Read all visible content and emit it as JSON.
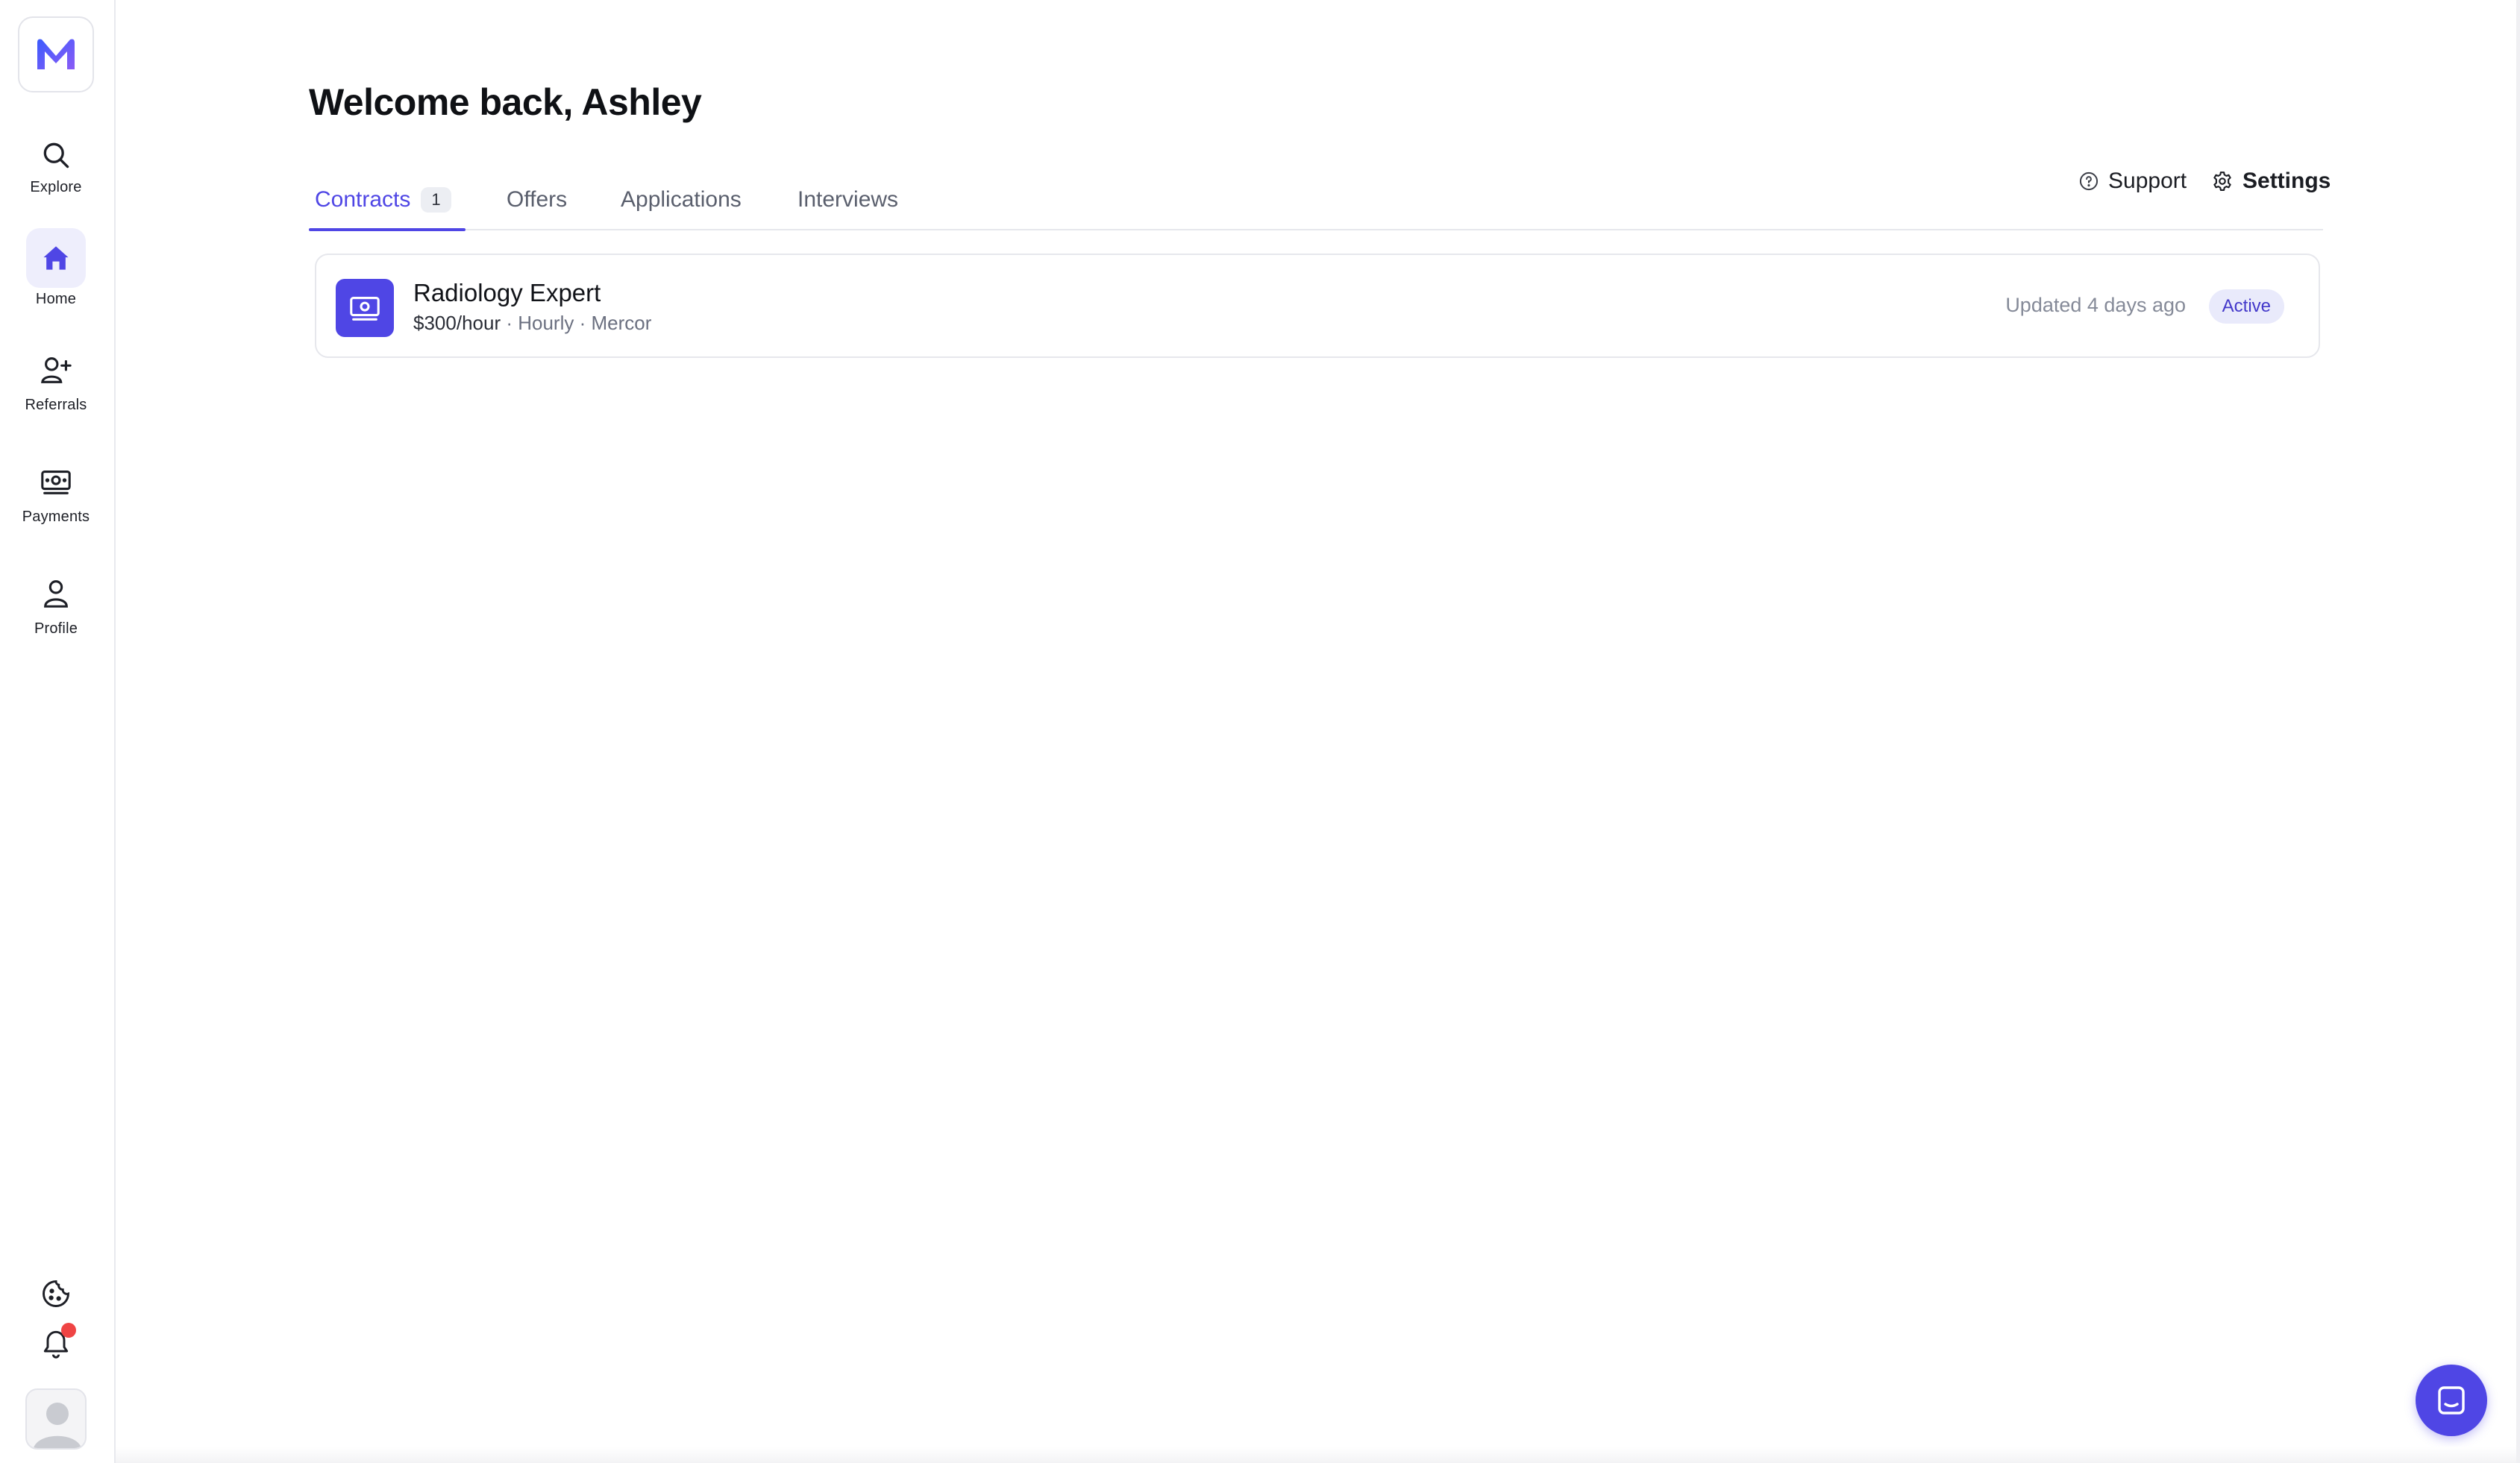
{
  "app": {
    "brand_letter": "M",
    "accent": "#4f46e5"
  },
  "sidebar": {
    "items": [
      {
        "label": "Explore",
        "icon": "search-icon"
      },
      {
        "label": "Home",
        "icon": "home-icon",
        "active": true
      },
      {
        "label": "Referrals",
        "icon": "add-user-icon"
      },
      {
        "label": "Payments",
        "icon": "money-icon"
      },
      {
        "label": "Profile",
        "icon": "user-icon"
      }
    ],
    "bottom": [
      "cookie-icon",
      "bell-icon",
      "avatar"
    ]
  },
  "main": {
    "greeting": "Welcome back, Ashley",
    "tabs": [
      {
        "label": "Contracts",
        "count": "1",
        "active": true
      },
      {
        "label": "Offers"
      },
      {
        "label": "Applications"
      },
      {
        "label": "Interviews"
      }
    ],
    "actions": {
      "support": "Support",
      "settings": "Settings"
    },
    "contracts": [
      {
        "title": "Radiology Expert",
        "rate": "$300/hour",
        "meta": " · Hourly · Mercor",
        "updated": "Updated 4 days ago",
        "status": "Active"
      }
    ]
  }
}
